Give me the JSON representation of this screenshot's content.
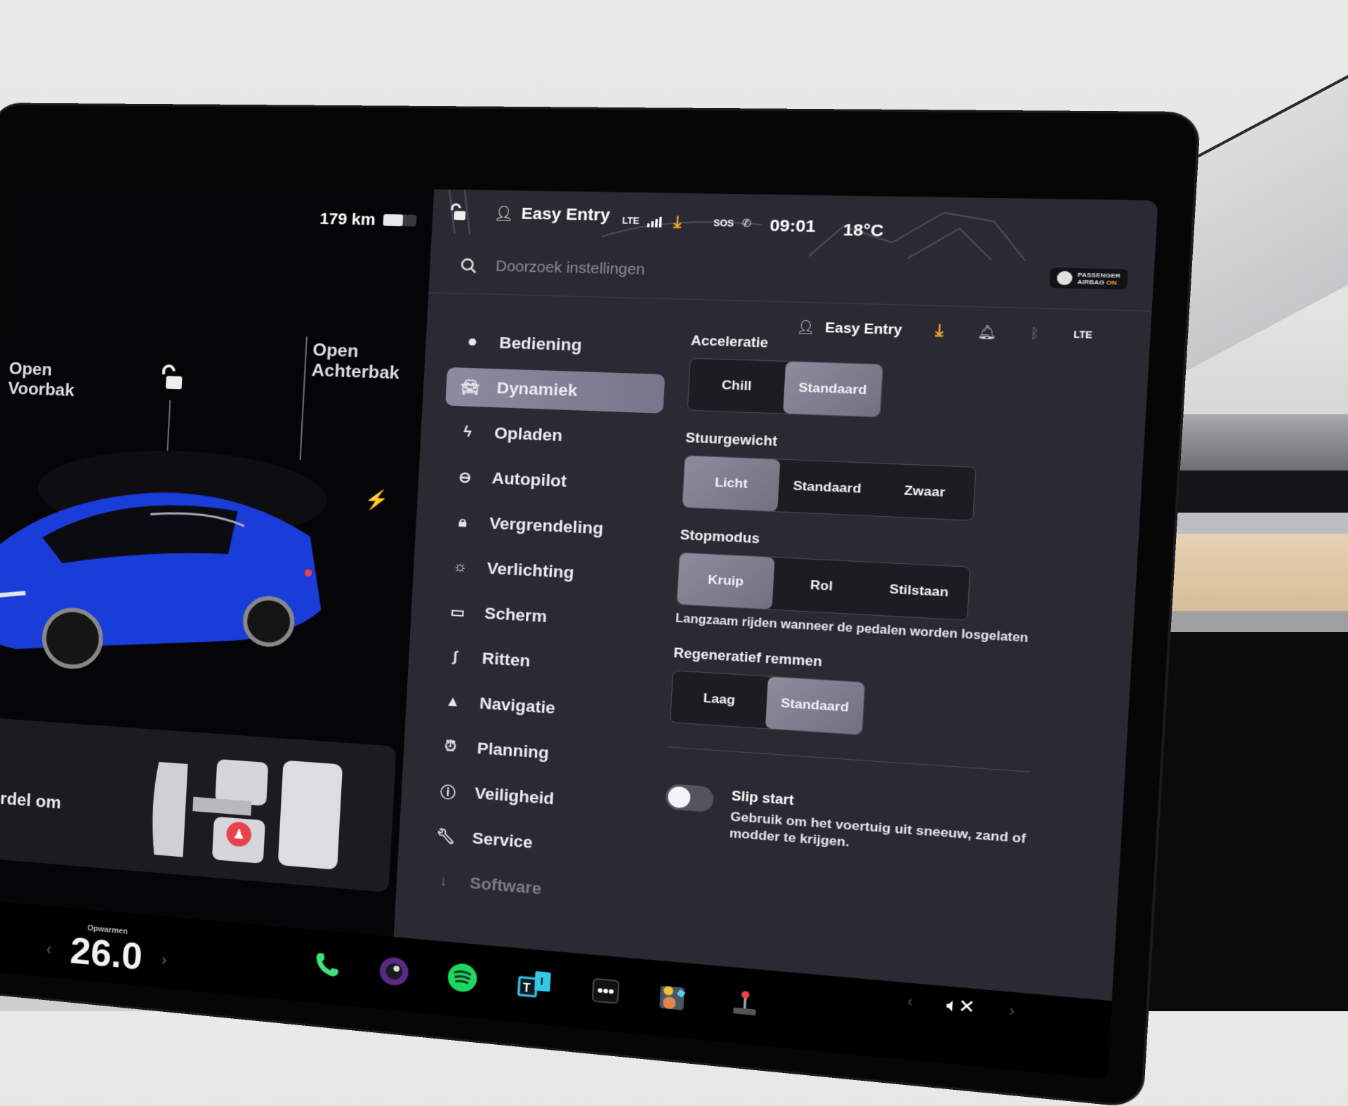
{
  "car_panel": {
    "range": "179 km",
    "battery_level": 0.6,
    "front_trunk": {
      "line1": "Open",
      "line2": "Voorbak"
    },
    "rear_trunk": {
      "line1": "Open",
      "line2": "Achterbak"
    },
    "seatbelt_text": "gordel om"
  },
  "statusbar": {
    "profile": "Easy Entry",
    "network": "LTE",
    "sos": "SOS",
    "time": "09:01",
    "temperature": "18°C",
    "airbag": {
      "line1": "PASSENGER",
      "line2": "AIRBAG",
      "state": "ON"
    }
  },
  "search": {
    "placeholder": "Doorzoek instellingen"
  },
  "subbar": {
    "profile": "Easy Entry",
    "network": "LTE"
  },
  "nav": {
    "items": [
      {
        "label": "Bediening",
        "icon": "toggle-icon"
      },
      {
        "label": "Dynamiek",
        "icon": "car-icon",
        "active": true
      },
      {
        "label": "Opladen",
        "icon": "bolt-icon"
      },
      {
        "label": "Autopilot",
        "icon": "steering-wheel-icon"
      },
      {
        "label": "Vergrendeling",
        "icon": "lock-icon"
      },
      {
        "label": "Verlichting",
        "icon": "sun-icon"
      },
      {
        "label": "Scherm",
        "icon": "display-icon"
      },
      {
        "label": "Ritten",
        "icon": "trips-icon"
      },
      {
        "label": "Navigatie",
        "icon": "navigation-arrow-icon"
      },
      {
        "label": "Planning",
        "icon": "alarm-clock-icon"
      },
      {
        "label": "Veiligheid",
        "icon": "alert-circle-icon"
      },
      {
        "label": "Service",
        "icon": "wrench-icon"
      },
      {
        "label": "Software",
        "icon": "download-icon"
      }
    ]
  },
  "dynamics": {
    "acceleration": {
      "title": "Acceleratie",
      "options": [
        "Chill",
        "Standaard"
      ],
      "selected": "Standaard"
    },
    "steering": {
      "title": "Stuurgewicht",
      "options": [
        "Licht",
        "Standaard",
        "Zwaar"
      ],
      "selected": "Licht"
    },
    "stop_mode": {
      "title": "Stopmodus",
      "options": [
        "Kruip",
        "Rol",
        "Stilstaan"
      ],
      "selected": "Kruip",
      "hint": "Langzaam rijden wanneer de pedalen worden losgelaten"
    },
    "regen": {
      "title": "Regeneratief remmen",
      "options": [
        "Laag",
        "Standaard"
      ],
      "selected": "Standaard"
    },
    "slip_start": {
      "title": "Slip start",
      "description": "Gebruik om het voertuig uit sneeuw, zand of modder te krijgen.",
      "enabled": false
    }
  },
  "dock": {
    "climate_label": "Opwarmen",
    "cabin_temp": "26.0",
    "apps": [
      "phone-icon",
      "camera-icon",
      "spotify-icon",
      "toybox-icon",
      "more-icon",
      "arcade-icon",
      "joystick-icon"
    ],
    "volume_state": "muted"
  },
  "colors": {
    "accent_download": "#f0a830",
    "phone": "#3ee07f",
    "spotify": "#1ed760",
    "alert": "#e8434c",
    "car": "#1a3cd8"
  }
}
